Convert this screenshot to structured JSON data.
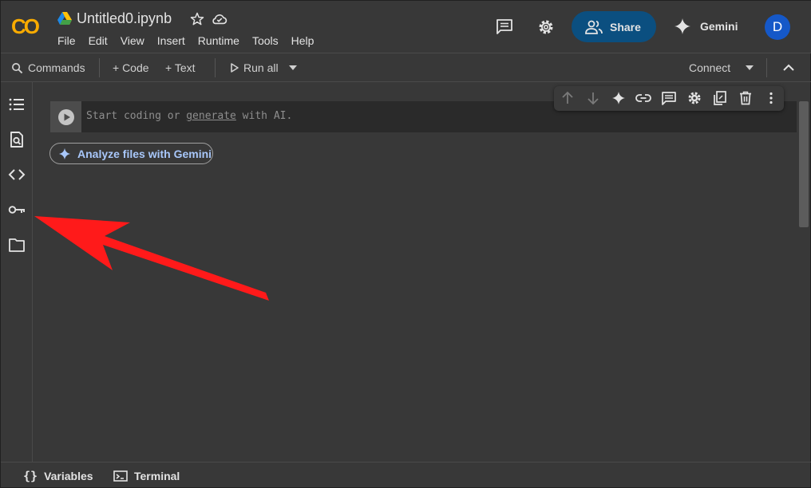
{
  "header": {
    "notebook_title": "Untitled0.ipynb",
    "menu": [
      "File",
      "Edit",
      "View",
      "Insert",
      "Runtime",
      "Tools",
      "Help"
    ],
    "share_label": "Share",
    "gemini_label": "Gemini",
    "avatar_initial": "D",
    "logo_text": "CO"
  },
  "toolbar": {
    "commands_label": "Commands",
    "code_label": "+ Code",
    "text_label": "+ Text",
    "run_all_label": "Run all",
    "connect_label": "Connect"
  },
  "sidebar": {
    "items": [
      {
        "icon": "table-of-contents-icon"
      },
      {
        "icon": "find-replace-icon"
      },
      {
        "icon": "code-snippets-icon"
      },
      {
        "icon": "secrets-key-icon"
      },
      {
        "icon": "files-folder-icon"
      }
    ]
  },
  "cell": {
    "placeholder_start": "Start coding or ",
    "placeholder_link": "generate",
    "placeholder_end": " with AI."
  },
  "cell_toolbar": {
    "icons": [
      "move-up-icon",
      "move-down-icon",
      "gemini-sparkle-icon",
      "link-icon",
      "comment-icon",
      "settings-icon",
      "mirror-cell-icon",
      "delete-icon",
      "more-vert-icon"
    ]
  },
  "analyze_chip": {
    "label": "Analyze files with Gemini"
  },
  "statusbar": {
    "variables_label": "Variables",
    "terminal_label": "Terminal"
  },
  "colors": {
    "background": "#383838",
    "share_button": "#0b4f80",
    "avatar": "#1558c8",
    "annotation_arrow": "#ff1a1a",
    "chip_text": "#a8c7fa"
  }
}
